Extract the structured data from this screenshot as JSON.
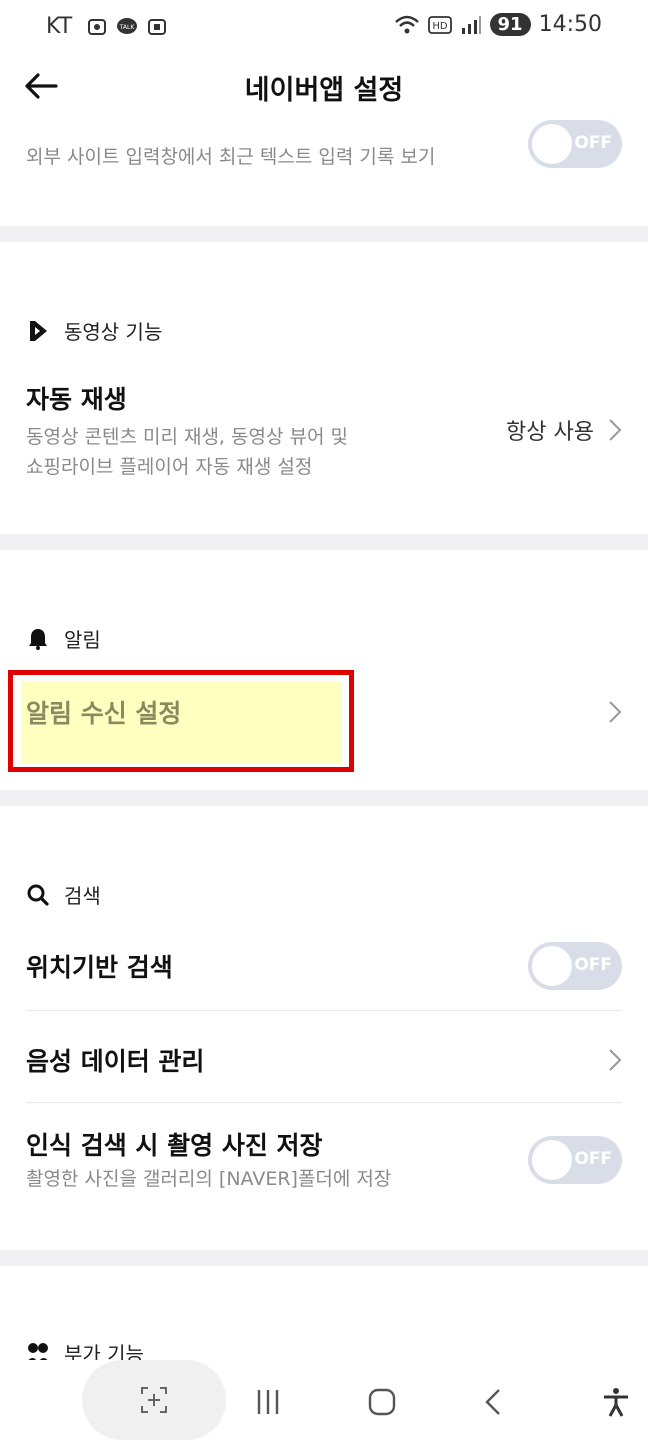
{
  "status_bar": {
    "carrier": "KT",
    "time": "14:50",
    "battery": "91",
    "icons": [
      "smart-capture-icon",
      "kakaotalk-icon",
      "screen-record-icon",
      "wifi-icon",
      "hd-icon",
      "signal-icon",
      "battery-icon"
    ]
  },
  "header": {
    "title": "네이버앱 설정",
    "back_icon": "arrow-left-icon"
  },
  "top_partial": {
    "desc": "외부 사이트 입력창에서 최근 텍스트 입력 기록 보기",
    "toggle_label": "OFF"
  },
  "video": {
    "section_label": "동영상 기능",
    "autoplay_title": "자동 재생",
    "autoplay_desc_1": "동영상 콘텐츠 미리 재생, 동영상 뷰어 및",
    "autoplay_desc_2": "쇼핑라이브 플레이어 자동 재생 설정",
    "autoplay_value": "항상 사용"
  },
  "notification": {
    "section_label": "알림",
    "settings_title": "알림 수신 설정"
  },
  "search": {
    "section_label": "검색",
    "location_title": "위치기반 검색",
    "location_toggle": "OFF",
    "voice_title": "음성 데이터 관리",
    "lens_title": "인식 검색 시 촬영 사진 저장",
    "lens_desc": "촬영한 사진을 갤러리의 [NAVER]폴더에 저장",
    "lens_toggle": "OFF"
  },
  "extra": {
    "section_label": "부가 기능"
  },
  "colors": {
    "toggle_off": "#d9dde8",
    "highlight_border": "#e00000",
    "highlight_fill": "#ffffc0",
    "divider": "#f1f1f3"
  }
}
